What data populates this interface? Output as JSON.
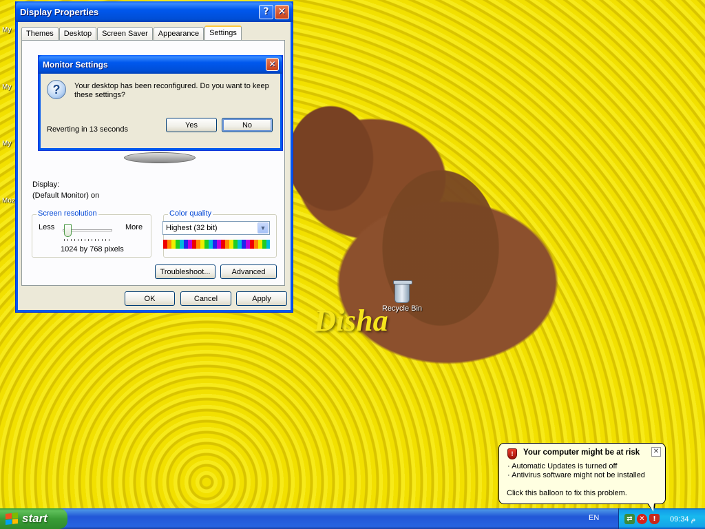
{
  "desktop": {
    "icon_fragments": [
      "My",
      "My",
      "My",
      "Moz"
    ],
    "wallpaper_text": "Disha",
    "recycle_bin_label": "Recycle Bin"
  },
  "display_properties": {
    "title": "Display Properties",
    "help_btn": "?",
    "close_btn": "✕",
    "tabs": [
      "Themes",
      "Desktop",
      "Screen Saver",
      "Appearance",
      "Settings"
    ],
    "active_tab": "Settings",
    "display_label": "Display:",
    "display_value": "(Default Monitor) on",
    "screen_resolution": {
      "legend": "Screen resolution",
      "less": "Less",
      "more": "More",
      "value": "1024 by 768 pixels"
    },
    "color_quality": {
      "legend": "Color quality",
      "selected": "Highest (32 bit)"
    },
    "buttons": {
      "troubleshoot": "Troubleshoot...",
      "advanced": "Advanced",
      "ok": "OK",
      "cancel": "Cancel",
      "apply": "Apply"
    }
  },
  "monitor_settings": {
    "title": "Monitor Settings",
    "close_btn": "✕",
    "message_line1": "Your desktop has been reconfigured.  Do you want to keep",
    "message_line2": "these settings?",
    "countdown": "Reverting in 13 seconds",
    "yes": "Yes",
    "no": "No"
  },
  "taskbar": {
    "start_label": "start",
    "language": "EN",
    "clock": "09:34 م"
  },
  "balloon": {
    "title": "Your computer might be at risk",
    "line1": "· Automatic Updates is turned off",
    "line2": "· Antivirus software might not be installed",
    "action": "Click this balloon to fix this problem.",
    "close_btn": "✕"
  },
  "colors": {
    "xp_blue": "#0058ee",
    "window_bg": "#ece9d8",
    "start_green": "#3a9d37",
    "balloon_bg": "#ffffe1",
    "wallpaper_text": "#f6e61c"
  }
}
